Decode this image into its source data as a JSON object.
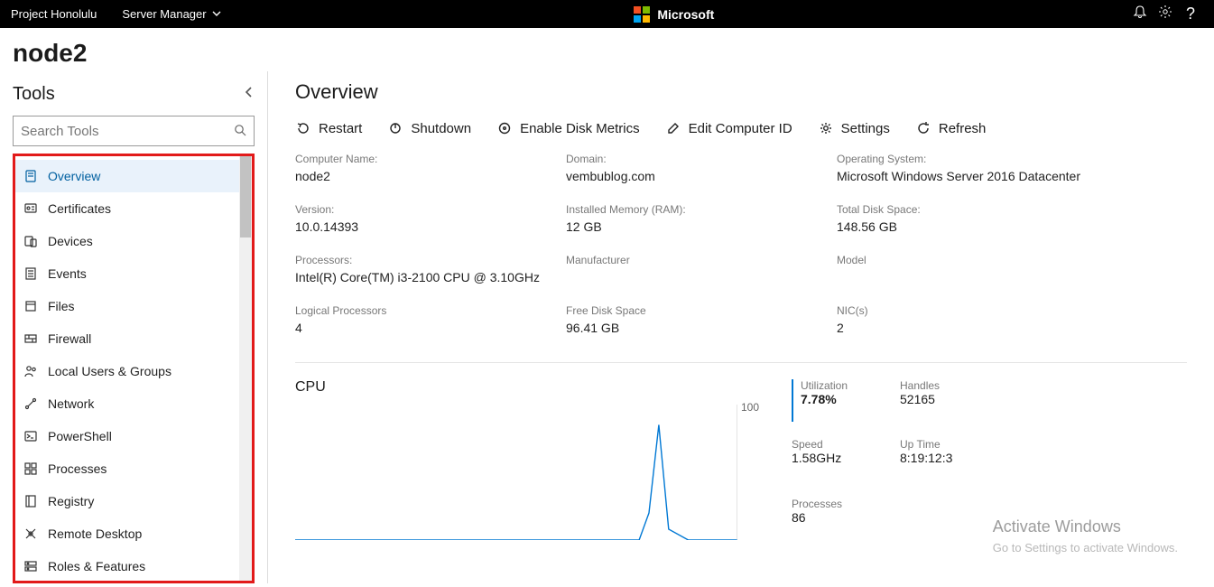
{
  "header": {
    "brand": "Project Honolulu",
    "dropdown": "Server Manager",
    "ms_label": "Microsoft",
    "help_glyph": "?"
  },
  "page_title": "node2",
  "sidebar": {
    "title": "Tools",
    "search_placeholder": "Search Tools",
    "items": [
      {
        "label": "Overview",
        "icon": "overview"
      },
      {
        "label": "Certificates",
        "icon": "certificates"
      },
      {
        "label": "Devices",
        "icon": "devices"
      },
      {
        "label": "Events",
        "icon": "events"
      },
      {
        "label": "Files",
        "icon": "files"
      },
      {
        "label": "Firewall",
        "icon": "firewall"
      },
      {
        "label": "Local Users & Groups",
        "icon": "users"
      },
      {
        "label": "Network",
        "icon": "network"
      },
      {
        "label": "PowerShell",
        "icon": "powershell"
      },
      {
        "label": "Processes",
        "icon": "processes"
      },
      {
        "label": "Registry",
        "icon": "registry"
      },
      {
        "label": "Remote Desktop",
        "icon": "remote"
      },
      {
        "label": "Roles & Features",
        "icon": "roles"
      }
    ],
    "active_index": 0
  },
  "main": {
    "heading": "Overview",
    "toolbar": [
      {
        "label": "Restart",
        "name": "restart-button",
        "icon": "restart"
      },
      {
        "label": "Shutdown",
        "name": "shutdown-button",
        "icon": "power"
      },
      {
        "label": "Enable Disk Metrics",
        "name": "enable-disk-metrics-button",
        "icon": "disk"
      },
      {
        "label": "Edit Computer ID",
        "name": "edit-computer-id-button",
        "icon": "edit"
      },
      {
        "label": "Settings",
        "name": "settings-button",
        "icon": "gear"
      },
      {
        "label": "Refresh",
        "name": "refresh-button",
        "icon": "refresh"
      }
    ],
    "info": [
      {
        "label": "Computer Name:",
        "value": "node2"
      },
      {
        "label": "Domain:",
        "value": "vembublog.com"
      },
      {
        "label": "Operating System:",
        "value": "Microsoft Windows Server 2016 Datacenter"
      },
      {
        "label": "Version:",
        "value": "10.0.14393"
      },
      {
        "label": "Installed Memory (RAM):",
        "value": "12 GB"
      },
      {
        "label": "Total Disk Space:",
        "value": "148.56 GB"
      },
      {
        "label": "Processors:",
        "value": "Intel(R) Core(TM) i3-2100 CPU @ 3.10GHz"
      },
      {
        "label": "Manufacturer",
        "value": ""
      },
      {
        "label": "Model",
        "value": ""
      },
      {
        "label": "Logical Processors",
        "value": "4"
      },
      {
        "label": "Free Disk Space",
        "value": "96.41 GB"
      },
      {
        "label": "NIC(s)",
        "value": "2"
      }
    ],
    "cpu": {
      "title": "CPU",
      "ymax": "100",
      "stats": [
        {
          "label": "Utilization",
          "value": "7.78%",
          "strong": true,
          "divider": true
        },
        {
          "label": "Handles",
          "value": "52165"
        },
        {
          "label": "Speed",
          "value": "1.58GHz"
        },
        {
          "label": "Up Time",
          "value": "8:19:12:3"
        },
        {
          "label": "Processes",
          "value": "86"
        }
      ]
    }
  },
  "watermark": {
    "title": "Activate Windows",
    "subtitle": "Go to Settings to activate Windows."
  },
  "chart_data": {
    "type": "line",
    "title": "CPU",
    "ylabel": "",
    "ylim": [
      0,
      100
    ],
    "x": [
      0,
      5,
      10,
      15,
      20,
      25,
      30,
      35,
      40,
      45,
      50,
      55,
      60,
      65,
      70,
      72,
      74,
      76,
      80,
      85,
      90
    ],
    "series": [
      {
        "name": "Utilization",
        "values": [
          0,
          0,
          0,
          0,
          0,
          0,
          0,
          0,
          0,
          0,
          0,
          0,
          0,
          0,
          0,
          20,
          85,
          8,
          0,
          0,
          0
        ]
      }
    ]
  }
}
